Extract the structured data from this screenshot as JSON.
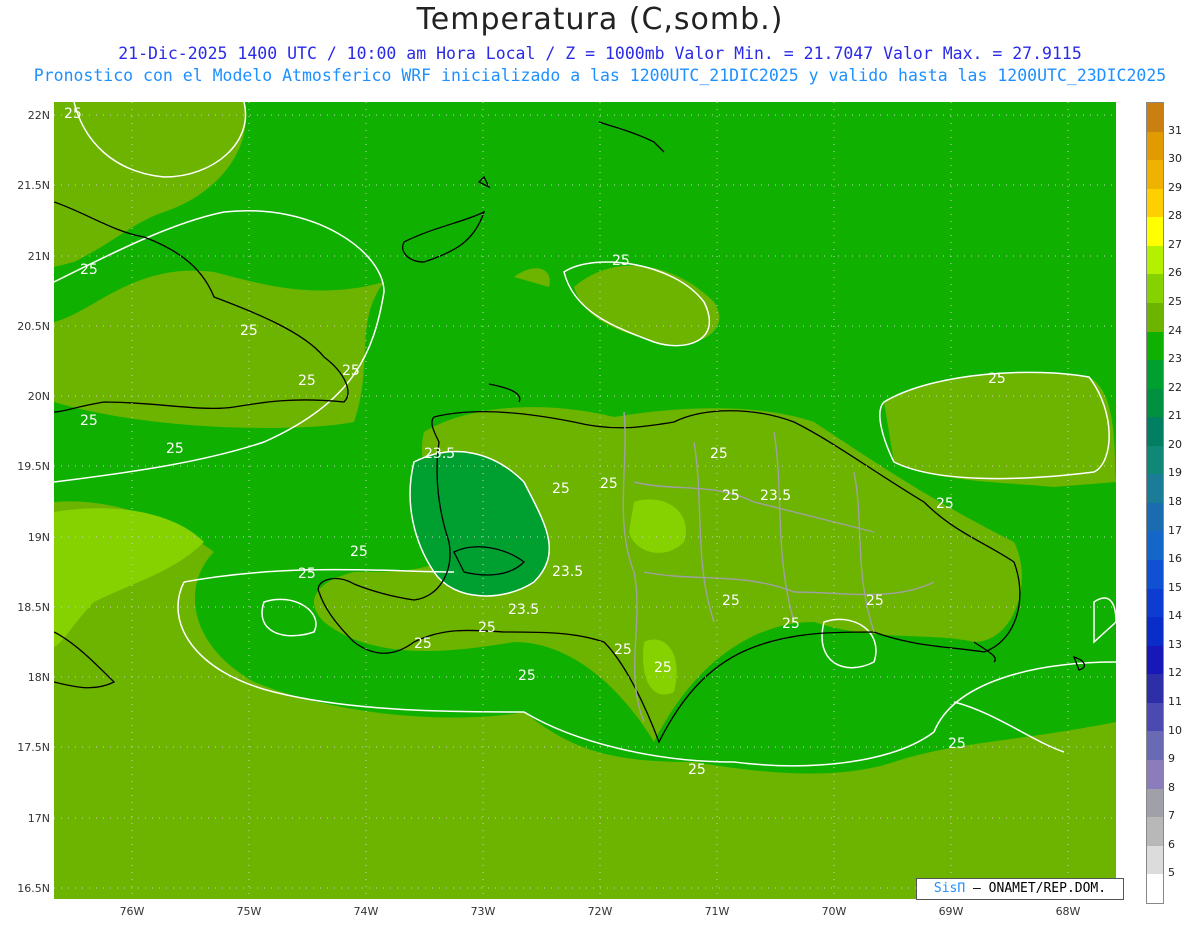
{
  "header": {
    "title": "Temperatura (C,somb.)",
    "line1": "21-Dic-2025 1400 UTC / 10:00 am Hora Local / Z = 1000mb  Valor Min. = 21.7047  Valor Max. = 27.9115",
    "line2": "Pronostico con el Modelo Atmosferico WRF inicializado a las 1200UTC_21DIC2025 y valido hasta las  1200UTC_23DIC2025"
  },
  "axes": {
    "lat_labels": [
      "22N",
      "21.5N",
      "21N",
      "20.5N",
      "20N",
      "19.5N",
      "19N",
      "18.5N",
      "18N",
      "17.5N",
      "17N",
      "16.5N"
    ],
    "lon_labels": [
      "76W",
      "75W",
      "74W",
      "73W",
      "72W",
      "71W",
      "70W",
      "69W",
      "68W"
    ]
  },
  "contour_labels": {
    "c25": "25",
    "c23_5": "23.5"
  },
  "colorbar": {
    "labels": [
      "31",
      "30",
      "29",
      "28",
      "27",
      "26",
      "25",
      "24",
      "23",
      "22",
      "21",
      "20",
      "19",
      "18",
      "17",
      "16",
      "15",
      "14",
      "13",
      "12",
      "11",
      "10",
      "9",
      "8",
      "7",
      "6",
      "5"
    ],
    "colors": [
      "#c98010",
      "#e19a00",
      "#f0b200",
      "#ffcf00",
      "#ffff00",
      "#b4f000",
      "#86d200",
      "#6cb400",
      "#10b000",
      "#00a030",
      "#009040",
      "#008060",
      "#108878",
      "#1a7c96",
      "#1a6cb0",
      "#1466c8",
      "#1050d2",
      "#0c3cd0",
      "#0a2cc8",
      "#1818b8",
      "#2e2ea8",
      "#4a4ab0",
      "#6a6ab4",
      "#8c7cbc",
      "#a0a0a8",
      "#b8b8b8",
      "#dcdcdc",
      "#ffffff"
    ]
  },
  "colors": {
    "ocean_24": "#10b000",
    "band_25": "#6cb400",
    "band_26": "#86d200",
    "band_23": "#00a030"
  },
  "credit": {
    "sis": "SisΠ",
    "rest": " – ONAMET/REP.DOM."
  }
}
